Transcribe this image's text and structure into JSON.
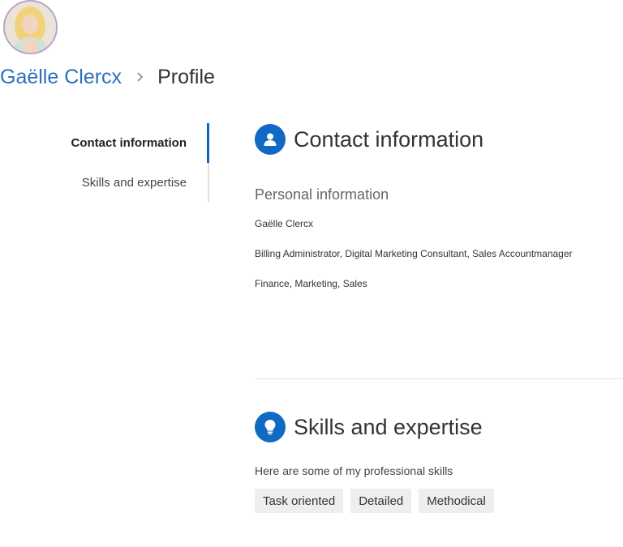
{
  "user": {
    "name": "Gaëlle Clercx"
  },
  "breadcrumb": {
    "parent": "Gaëlle Clercx",
    "separator_icon": "chevron-right-icon",
    "current": "Profile"
  },
  "nav": {
    "items": [
      {
        "label": "Contact information",
        "active": true
      },
      {
        "label": "Skills and expertise",
        "active": false
      }
    ]
  },
  "contact": {
    "title": "Contact information",
    "icon": "person-icon",
    "subtitle": "Personal information",
    "name": "Gaëlle Clercx",
    "roles": "Billing Administrator, Digital Marketing Consultant, Sales Accountmanager",
    "departments": "Finance, Marketing, Sales"
  },
  "skills": {
    "title": "Skills and expertise",
    "icon": "lightbulb-icon",
    "intro": "Here are some of my professional skills",
    "chips": [
      "Task oriented",
      "Detailed",
      "Methodical"
    ]
  },
  "colors": {
    "accent": "#1069c3",
    "link": "#2b6fc0",
    "chip_bg": "#eeeeee"
  }
}
